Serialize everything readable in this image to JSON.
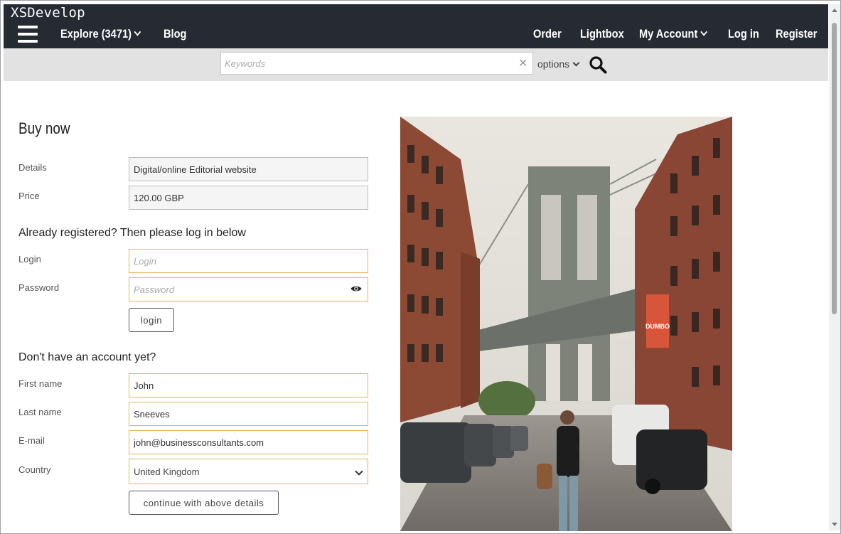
{
  "app": {
    "title": "XSDevelop"
  },
  "nav": {
    "explore_label": "Explore (3471)",
    "blog_label": "Blog",
    "order_label": "Order",
    "lightbox_label": "Lightbox",
    "my_account_label": "My Account",
    "login_label": "Log in",
    "register_label": "Register"
  },
  "search": {
    "placeholder": "Keywords",
    "value": "",
    "options_label": "options"
  },
  "form": {
    "heading": "Buy now",
    "details_label": "Details",
    "details_value": "Digital/online Editorial website",
    "price_label": "Price",
    "price_value": "120.00 GBP",
    "registered_title": "Already registered? Then please log in below",
    "login_label": "Login",
    "login_placeholder": "Login",
    "password_label": "Password",
    "password_placeholder": "Password",
    "login_button": "login",
    "no_account_title": "Don't have an account yet?",
    "first_name_label": "First name",
    "first_name_value": "John",
    "last_name_label": "Last name",
    "last_name_value": "Sneeves",
    "email_label": "E-mail",
    "email_value": "john@businessconsultants.com",
    "country_label": "Country",
    "country_value": "United Kingdom",
    "continue_button": "continue with above details"
  },
  "photo": {
    "banner_text": "DUMBO"
  },
  "icons": {
    "menu": "hamburger-icon",
    "clear": "close-icon",
    "search": "search-icon",
    "password_toggle": "eye-icon",
    "dropdown": "chevron-down-icon"
  },
  "colors": {
    "header_bg": "#252a33",
    "searchbar_bg": "#e2e2e2",
    "focus_border": "#e6b35a"
  }
}
